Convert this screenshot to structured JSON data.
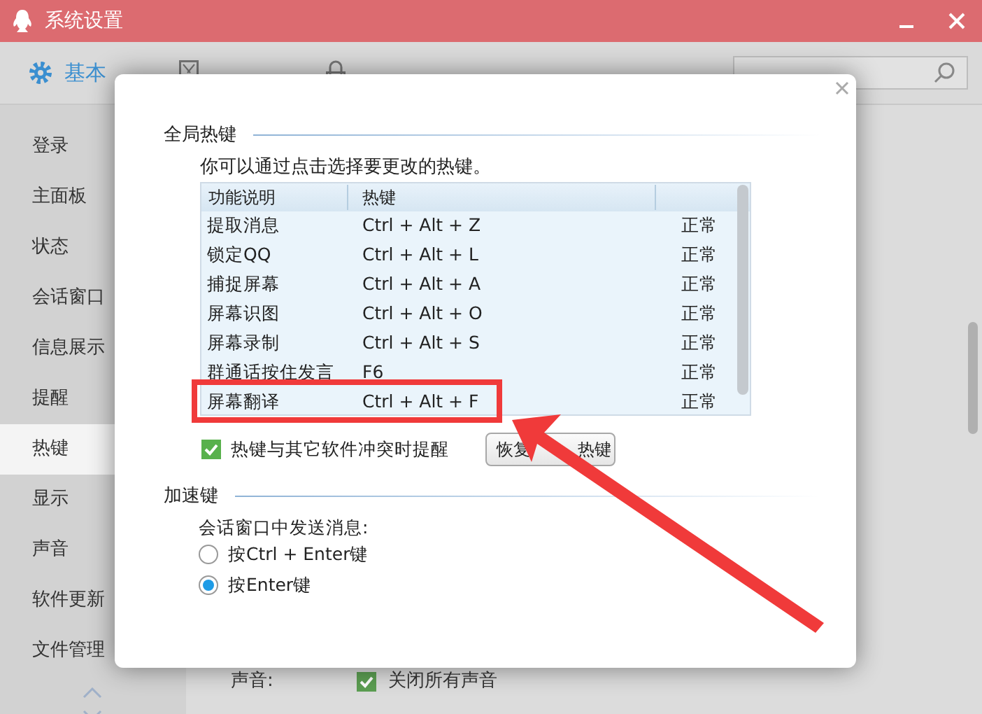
{
  "window": {
    "title": "系统设置"
  },
  "tabs": [
    {
      "label": "基本",
      "selected": true
    },
    {
      "selected": false
    },
    {
      "selected": false
    }
  ],
  "sidebar": {
    "items": [
      {
        "label": "登录",
        "selected": false
      },
      {
        "label": "主面板",
        "selected": false
      },
      {
        "label": "状态",
        "selected": false
      },
      {
        "label": "会话窗口",
        "selected": false
      },
      {
        "label": "信息展示",
        "selected": false
      },
      {
        "label": "提醒",
        "selected": false
      },
      {
        "label": "热键",
        "selected": true
      },
      {
        "label": "显示",
        "selected": false
      },
      {
        "label": "声音",
        "selected": false
      },
      {
        "label": "软件更新",
        "selected": false
      },
      {
        "label": "文件管理",
        "selected": false
      }
    ]
  },
  "background_row": {
    "label": "声音:",
    "option": "关闭所有声音",
    "checked": true
  },
  "dialog": {
    "global_hotkeys": {
      "heading": "全局热键",
      "description": "你可以通过点击选择要更改的热键。",
      "table": {
        "columns": [
          "功能说明",
          "热键"
        ],
        "rows": [
          {
            "function": "提取消息",
            "hotkey": "Ctrl + Alt + Z",
            "status": "正常"
          },
          {
            "function": "锁定QQ",
            "hotkey": "Ctrl + Alt + L",
            "status": "正常"
          },
          {
            "function": "捕捉屏幕",
            "hotkey": "Ctrl + Alt + A",
            "status": "正常"
          },
          {
            "function": "屏幕识图",
            "hotkey": "Ctrl + Alt + O",
            "status": "正常"
          },
          {
            "function": "屏幕录制",
            "hotkey": "Ctrl + Alt + S",
            "status": "正常"
          },
          {
            "function": "群通话按住发言",
            "hotkey": "F6",
            "status": "正常"
          },
          {
            "function": "屏幕翻译",
            "hotkey": "Ctrl + Alt + F",
            "status": "正常"
          }
        ]
      },
      "conflict_alert": {
        "label": "热键与其它软件冲突时提醒",
        "checked": true
      },
      "restore_button": {
        "label_start": "恢复",
        "label_end": "热键"
      }
    },
    "accelerators": {
      "heading": "加速键",
      "prompt": "会话窗口中发送消息:",
      "options": [
        {
          "label": "按Ctrl + Enter键",
          "selected": false
        },
        {
          "label": "按Enter键",
          "selected": true
        }
      ]
    }
  }
}
